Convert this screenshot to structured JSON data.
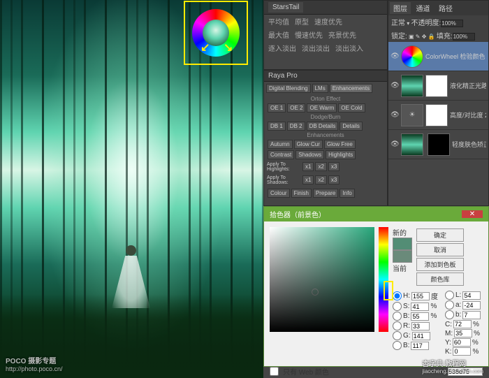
{
  "watermark1": {
    "title": "POCO 摄影专题",
    "url": "http://photo.poco.cn/"
  },
  "watermark2": {
    "title": "杏字典 教程网",
    "url": "jiaocheng.chazidian.com"
  },
  "starstail": {
    "tab": "StarsTail",
    "rows": [
      [
        "平均值",
        "原型",
        "速度优先"
      ],
      [
        "最大值",
        "慢速优先",
        "亮景优先"
      ],
      [
        "逐入淡出",
        "淡出淡出",
        "淡出淡入"
      ]
    ]
  },
  "raya": {
    "title": "Raya Pro",
    "tabs": [
      "Digital Blending",
      "LMs",
      "Enhancements"
    ],
    "orton": "Orton Effect",
    "orton_btns": [
      "OE 1",
      "OE 2",
      "OE Warm",
      "OE Cold"
    ],
    "dodge": "Dodge/Burn",
    "dodge_btns": [
      "DB 1",
      "DB 2",
      "DB Details",
      "Details"
    ],
    "enh": "Enhancements",
    "enh_btns": [
      "Autumn",
      "Glow Cur",
      "Glow Free",
      "Contrast",
      "Shadows",
      "Highlights"
    ],
    "apply1": "Apply To Highlights:",
    "apply2": "Apply To Shadows:",
    "x_btns": [
      "x1",
      "x2",
      "x3"
    ],
    "bottom": [
      "Colour",
      "Finish",
      "Prepare",
      "Info"
    ]
  },
  "layers_panel": {
    "tabs": [
      "图层",
      "通道",
      "路径"
    ],
    "mode_label": "正常",
    "opacity_label": "不透明度:",
    "opacity": "100%",
    "lock_label": "锁定:",
    "fill_label": "填充:",
    "fill": "100%",
    "layers": [
      {
        "name": "ColorWheel 检验颜色"
      },
      {
        "name": "液化精正光路 ..."
      },
      {
        "name": "高度/对比度 2"
      },
      {
        "name": "轻度肤色矫正 ..."
      }
    ]
  },
  "picker": {
    "title": "拾色器（前景色）",
    "ok": "确定",
    "cancel": "取消",
    "add": "添加到色板",
    "lib": "颜色库",
    "new_label": "新的",
    "current_label": "当前",
    "web_only": "只有 Web 颜色",
    "hex_label": "#",
    "hex": "538d75",
    "H": {
      "label": "H:",
      "val": "155",
      "unit": "度"
    },
    "S": {
      "label": "S:",
      "val": "41",
      "unit": "%"
    },
    "Bv": {
      "label": "B:",
      "val": "55",
      "unit": "%"
    },
    "R": {
      "label": "R:",
      "val": "33"
    },
    "G": {
      "label": "G:",
      "val": "141"
    },
    "Bc": {
      "label": "B:",
      "val": "117"
    },
    "L": {
      "label": "L:",
      "val": "54"
    },
    "a": {
      "label": "a:",
      "val": "-24"
    },
    "b": {
      "label": "b:",
      "val": "7"
    },
    "C": {
      "label": "C:",
      "val": "72",
      "unit": "%"
    },
    "M": {
      "label": "M:",
      "val": "35",
      "unit": "%"
    },
    "Y": {
      "label": "Y:",
      "val": "60",
      "unit": "%"
    },
    "K": {
      "label": "K:",
      "val": "0",
      "unit": "%"
    },
    "swatch_new": "#538d75",
    "swatch_cur": "#6a8a7a"
  }
}
